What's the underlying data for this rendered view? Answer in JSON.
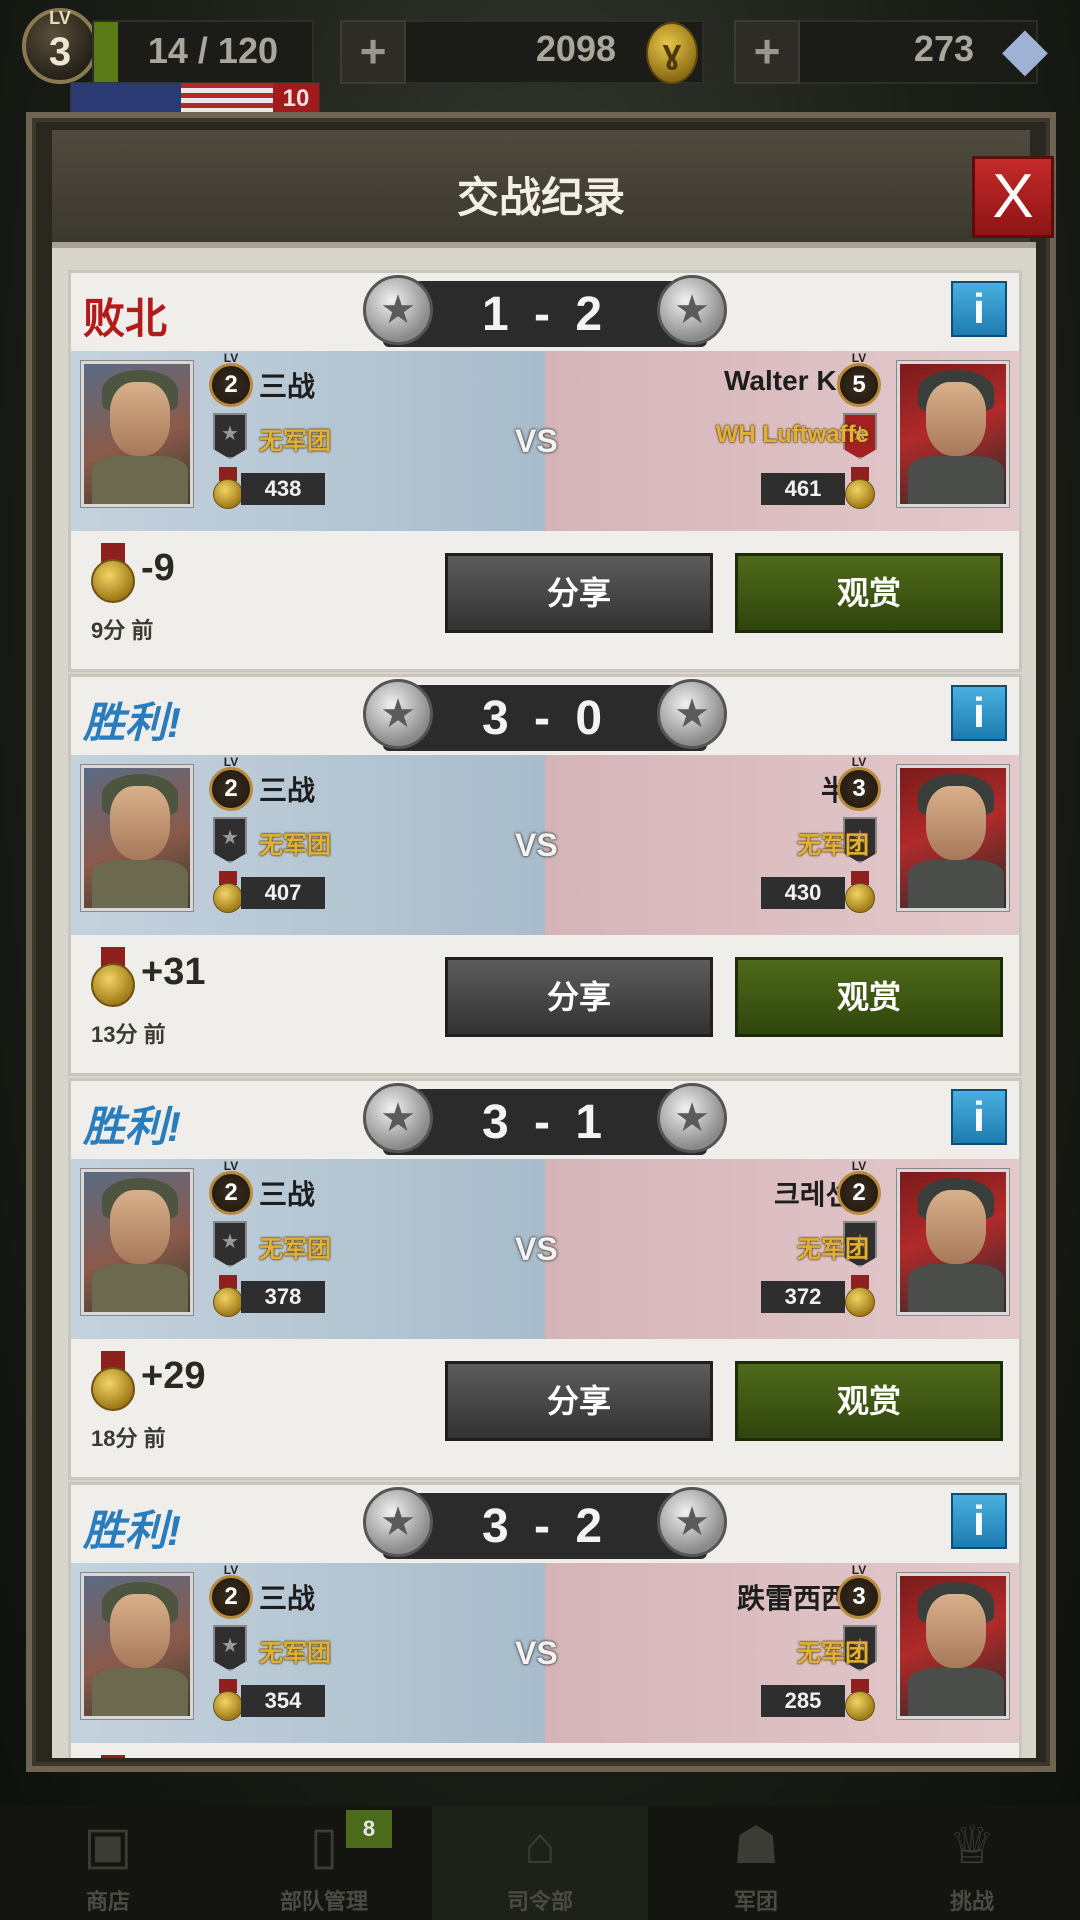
{
  "hud": {
    "level_tag": "LV",
    "level": "3",
    "energy": "14 / 120",
    "flag_count": "10",
    "plus": "+",
    "gold": "2098",
    "gems": "273"
  },
  "panel": {
    "title": "交战纪录",
    "close": "X",
    "vs": "VS",
    "share_label": "分享",
    "watch_label": "观赏",
    "info": "i",
    "lv_small": "LV"
  },
  "records": [
    {
      "result": "败北",
      "score": "1 - 2",
      "left": {
        "level": "2",
        "name": "三战",
        "clan": "无军团",
        "points": "438"
      },
      "right": {
        "level": "5",
        "name": "Walter Kutz",
        "clan": "WH Luftwaffe",
        "points": "461"
      },
      "delta": "-9",
      "ago": "9分 前"
    },
    {
      "result": "胜利!",
      "score": "3 - 0",
      "left": {
        "level": "2",
        "name": "三战",
        "clan": "无军团",
        "points": "407"
      },
      "right": {
        "level": "3",
        "name": "半夜",
        "clan": "无军团",
        "points": "430"
      },
      "delta": "+31",
      "ago": "13分 前"
    },
    {
      "result": "胜利!",
      "score": "3 - 1",
      "left": {
        "level": "2",
        "name": "三战",
        "clan": "无军团",
        "points": "378"
      },
      "right": {
        "level": "2",
        "name": "크레센도",
        "clan": "无军团",
        "points": "372"
      },
      "delta": "+29",
      "ago": "18分 前"
    },
    {
      "result": "胜利!",
      "score": "3 - 2",
      "left": {
        "level": "2",
        "name": "三战",
        "clan": "无军团",
        "points": "354"
      },
      "right": {
        "level": "3",
        "name": "跌雷西西西",
        "clan": "无军团",
        "points": "285"
      },
      "delta": "",
      "ago": ""
    }
  ],
  "nav": {
    "items": [
      {
        "label": "商店",
        "icon": "shop-icon"
      },
      {
        "label": "部队管理",
        "icon": "cards-icon",
        "badge": "8"
      },
      {
        "label": "司令部",
        "icon": "hq-icon"
      },
      {
        "label": "军团",
        "icon": "group-icon"
      },
      {
        "label": "挑战",
        "icon": "trophy-icon"
      }
    ]
  }
}
